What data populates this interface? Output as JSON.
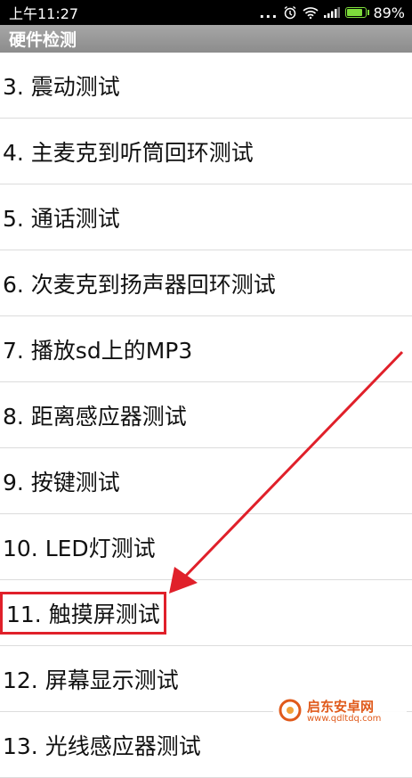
{
  "status_bar": {
    "time": "上午11:27",
    "dots": "...",
    "battery_percent": "89%",
    "battery_level": 0.89,
    "icons": [
      "alarm-icon",
      "wifi-icon",
      "signal-icon",
      "battery-icon"
    ]
  },
  "app_bar": {
    "title": "硬件检测"
  },
  "list": {
    "items": [
      {
        "label": "3. 震动测试"
      },
      {
        "label": "4. 主麦克到听筒回环测试"
      },
      {
        "label": "5. 通话测试"
      },
      {
        "label": "6. 次麦克到扬声器回环测试"
      },
      {
        "label": "7. 播放sd上的MP3"
      },
      {
        "label": "8. 距离感应器测试"
      },
      {
        "label": "9. 按键测试"
      },
      {
        "label": "10. LED灯测试"
      },
      {
        "label": "11. 触摸屏测试",
        "highlighted": true
      },
      {
        "label": "12. 屏幕显示测试"
      },
      {
        "label": "13. 光线感应器测试"
      }
    ]
  },
  "watermark": {
    "name": "启东安卓网",
    "url": "www.qdltdq.com"
  },
  "colors": {
    "annotation": "#e0202a",
    "battery": "#7ddc3b",
    "watermark": "#e05a1b"
  }
}
